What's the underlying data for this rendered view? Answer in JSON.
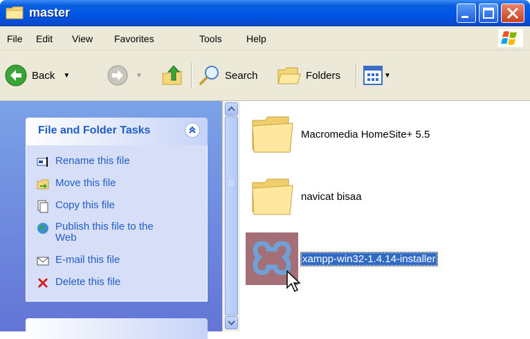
{
  "window": {
    "title": "master"
  },
  "menu": [
    "File",
    "Edit",
    "View",
    "Favorites",
    "Tools",
    "Help"
  ],
  "toolbar": {
    "back_label": "Back",
    "search_label": "Search",
    "folders_label": "Folders"
  },
  "task_panel": {
    "title": "File and Folder Tasks",
    "items": [
      {
        "label": "Rename this file",
        "icon": "rename-icon"
      },
      {
        "label": "Move this file",
        "icon": "move-icon"
      },
      {
        "label": "Copy this file",
        "icon": "copy-icon"
      },
      {
        "label": "Publish this file to the Web",
        "icon": "publish-web-icon"
      },
      {
        "label": "E-mail this file",
        "icon": "email-icon"
      },
      {
        "label": "Delete this file",
        "icon": "delete-icon"
      }
    ]
  },
  "files": [
    {
      "name": "Macromedia HomeSite+ 5.5",
      "type": "folder"
    },
    {
      "name": "navicat bisaa",
      "type": "folder"
    },
    {
      "name": "xampp-win32-1.4.14-installer",
      "type": "installer",
      "selected": true
    }
  ],
  "colors": {
    "titlebar": "#0054e3",
    "taskpane": "#6f8ddb",
    "link": "#215dc6",
    "selection": "#316ac5"
  }
}
